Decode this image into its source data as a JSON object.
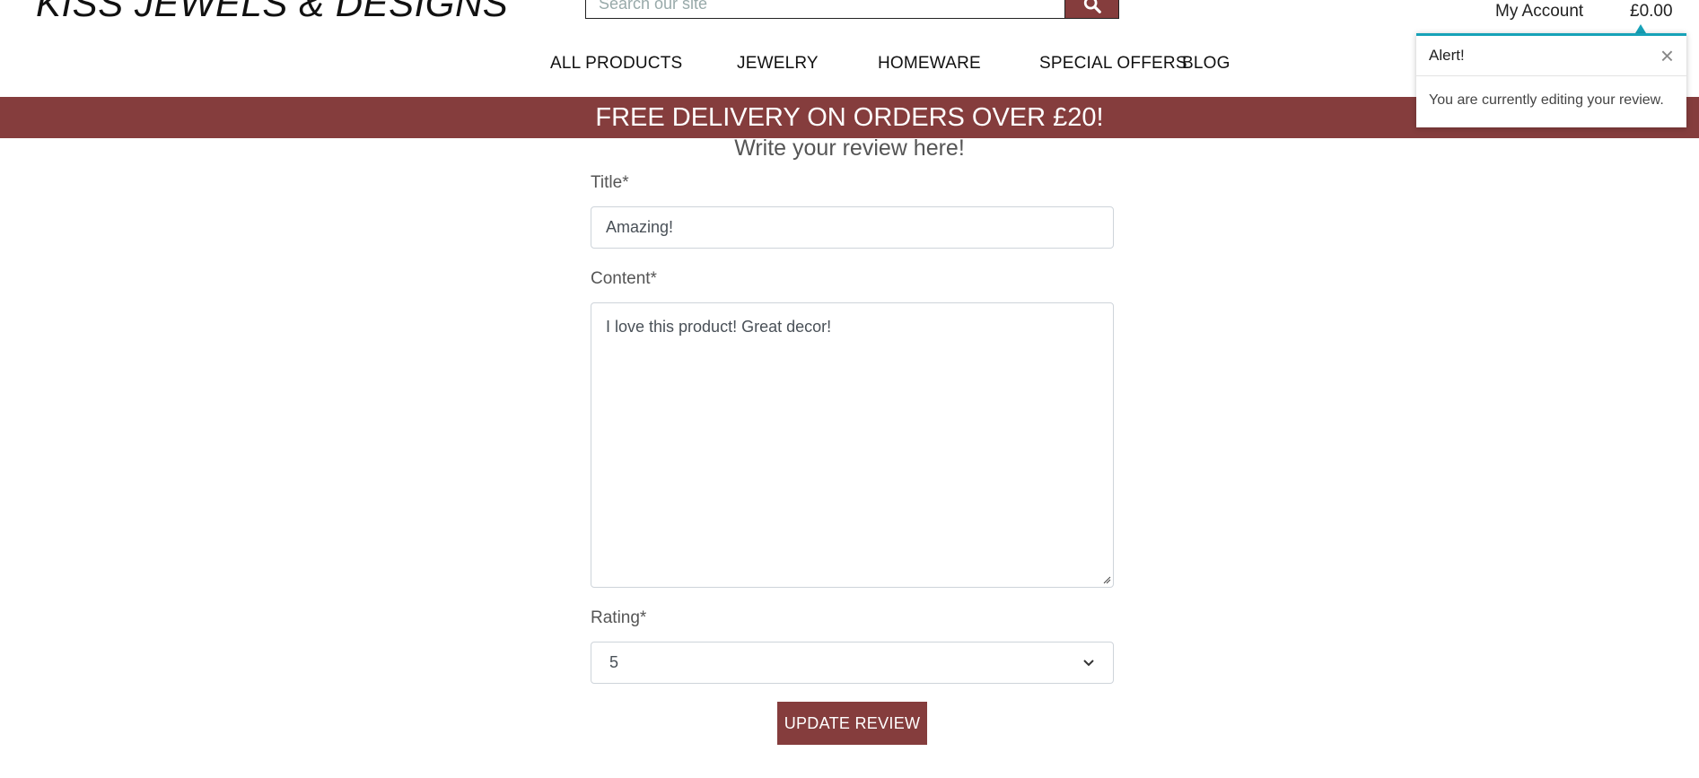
{
  "header": {
    "logo_text": "KISS JEWELS & DESIGNS",
    "search_placeholder": "Search our site",
    "account_label": "My Account",
    "cart_total": "£0.00"
  },
  "nav": {
    "items": [
      "ALL PRODUCTS",
      "JEWELRY",
      "HOMEWARE",
      "SPECIAL OFFERS",
      "BLOG"
    ]
  },
  "banner": {
    "text": "FREE DELIVERY ON ORDERS OVER £20!"
  },
  "form": {
    "heading": "Write your review here!",
    "title_label": "Title*",
    "title_value": "Amazing!",
    "content_label": "Content*",
    "content_value": "I love this product! Great decor!",
    "rating_label": "Rating*",
    "rating_value": "5",
    "submit_label": "UPDATE REVIEW"
  },
  "toast": {
    "title": "Alert!",
    "message": "You are currently editing your review."
  },
  "colors": {
    "brand": "#853d3d",
    "toast_accent": "#17a2b8"
  }
}
